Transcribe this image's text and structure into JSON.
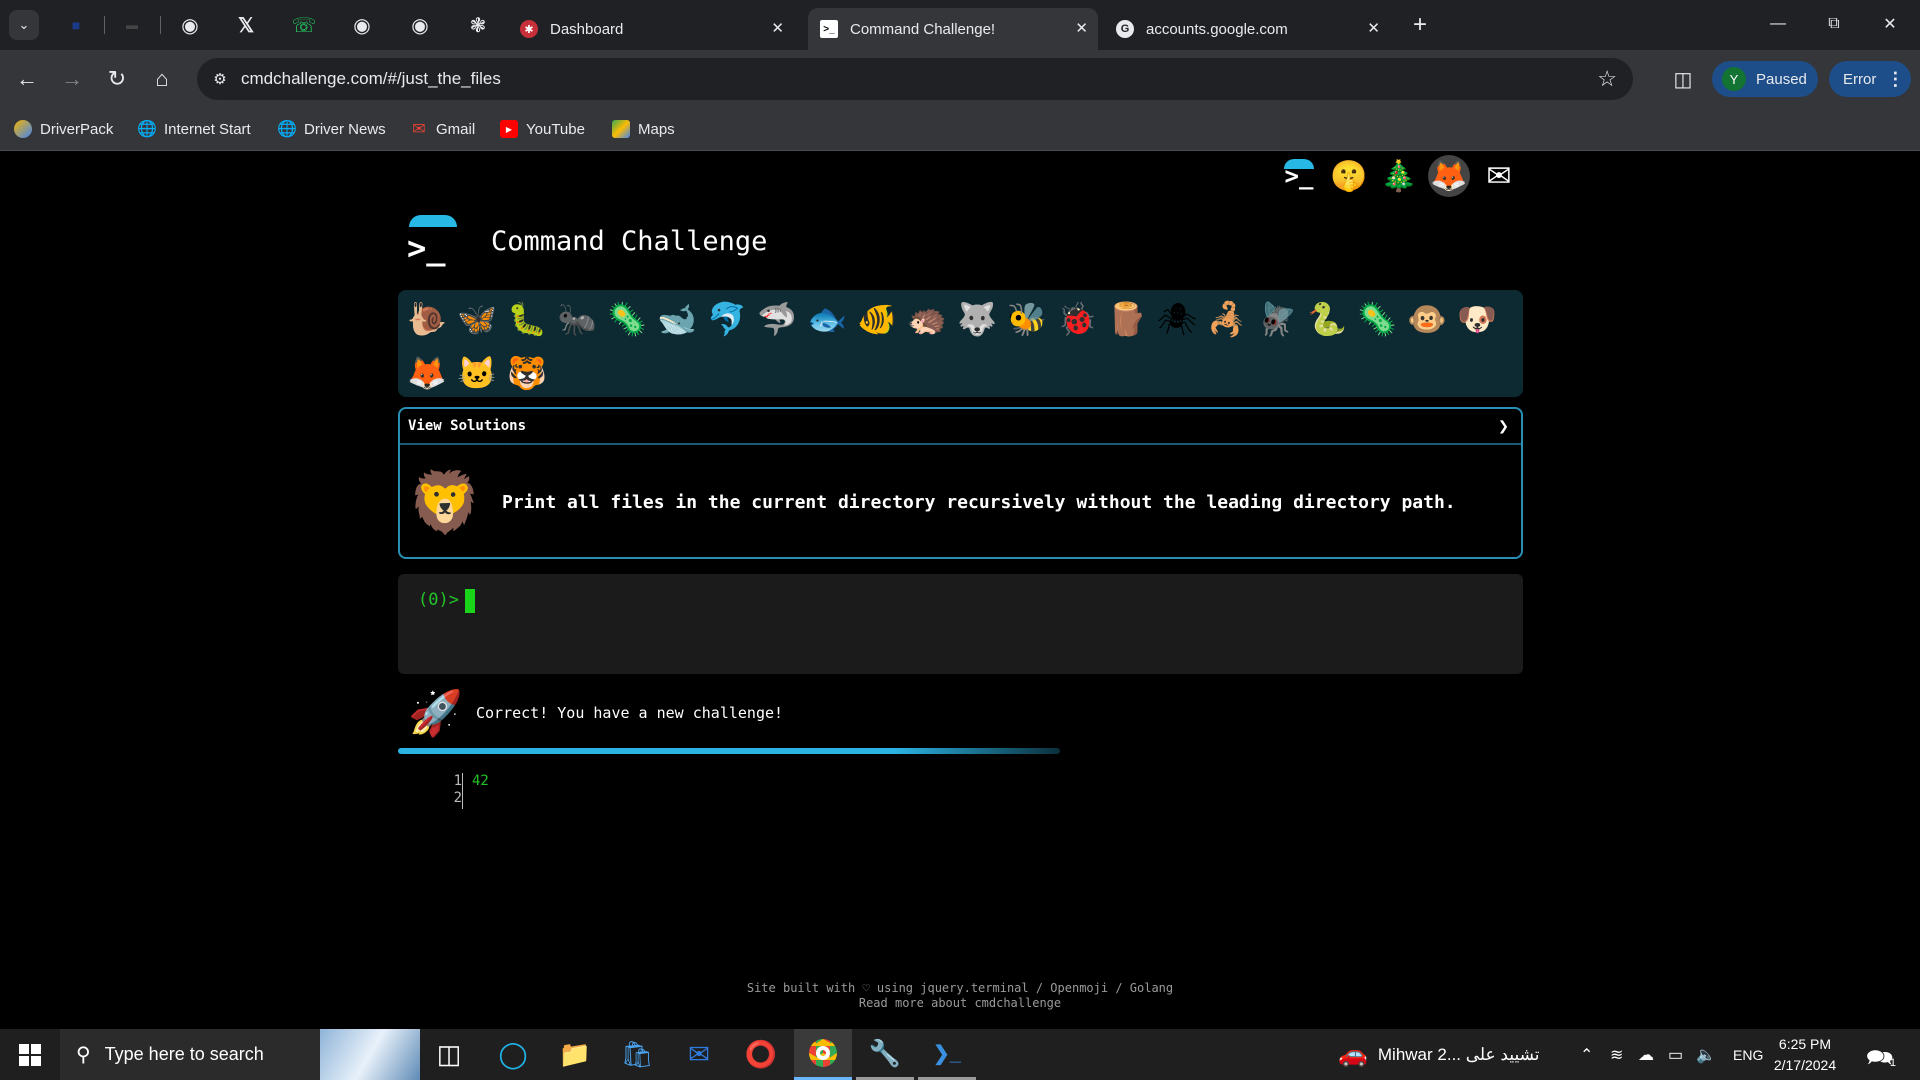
{
  "browser": {
    "tabs": [
      {
        "title": "Dashboard"
      },
      {
        "title": "Command Challenge!"
      },
      {
        "title": "accounts.google.com"
      }
    ],
    "url": "cmdchallenge.com/#/just_the_files",
    "profile_label": "Paused",
    "profile_initial": "Y",
    "error_label": "Error",
    "bookmarks": [
      {
        "label": "DriverPack"
      },
      {
        "label": "Internet Start"
      },
      {
        "label": "Driver News"
      },
      {
        "label": "Gmail"
      },
      {
        "label": "YouTube"
      },
      {
        "label": "Maps"
      }
    ]
  },
  "page": {
    "title": "Command Challenge",
    "view_solutions": "View Solutions",
    "task": "Print all files in the current directory recursively without the leading directory path.",
    "prompt": "(0)>",
    "status": "Correct! You have a new challenge!",
    "output": {
      "line_numbers": "1\n2",
      "lines": "42\n"
    },
    "footer_line1": "Site built with ♡ using jquery.terminal / Openmoji / Golang",
    "footer_line2": "Read more about cmdchallenge"
  },
  "taskbar": {
    "search_placeholder": "Type here to search",
    "news": "Mihwar 2... تشييد على",
    "language": "ENG",
    "time": "6:25 PM",
    "date": "2/17/2024",
    "notification_count": "1"
  }
}
